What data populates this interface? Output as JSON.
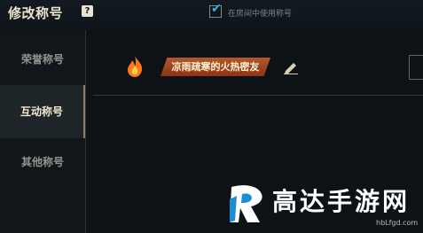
{
  "header": {
    "title": "修改称号",
    "help_icon": "?",
    "use_in_room_label": "在房间中使用称号",
    "use_in_room_checked": true
  },
  "sidebar": {
    "items": [
      {
        "label": "荣誉称号",
        "active": false
      },
      {
        "label": "互动称号",
        "active": true
      },
      {
        "label": "其他称号",
        "active": false
      }
    ]
  },
  "main": {
    "title_badge": {
      "label": "凉雨疏寒的火热密友",
      "icon": "fire-icon"
    },
    "edit_icon": "pencil-icon"
  },
  "watermark": {
    "brand": "高达手游网",
    "url": "hbLfgd.com"
  },
  "colors": {
    "accent": "#2fb5e5",
    "banner": "#a1441f",
    "background": "#0d1217"
  }
}
